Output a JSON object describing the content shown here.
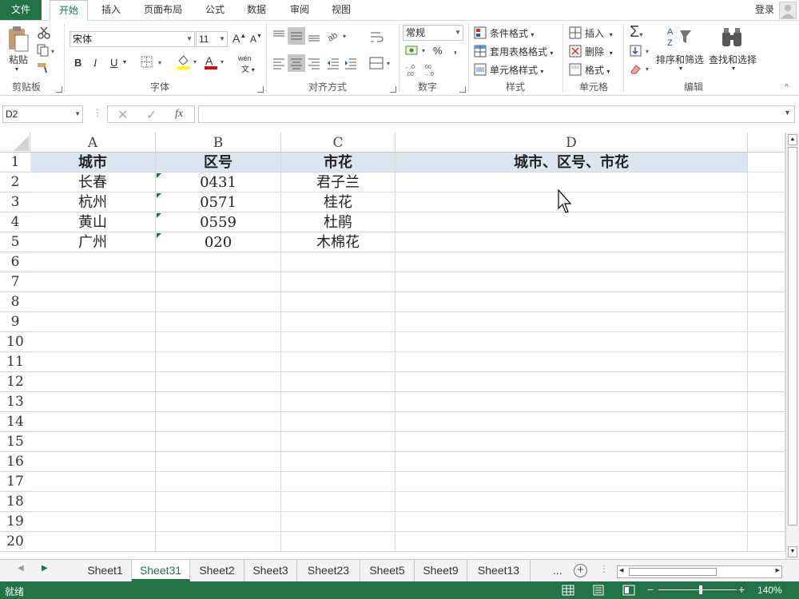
{
  "tabs": {
    "file": "文件",
    "home": "开始",
    "insert": "插入",
    "page_layout": "页面布局",
    "formulas": "公式",
    "data": "数据",
    "review": "审阅",
    "view": "视图",
    "login": "登录"
  },
  "ribbon": {
    "clipboard": {
      "paste": "粘贴",
      "label": "剪贴板"
    },
    "font": {
      "name": "宋体",
      "size": "11",
      "bold": "B",
      "italic": "I",
      "underline": "U",
      "label": "字体",
      "phonetic": "wén"
    },
    "alignment": {
      "label": "对齐方式"
    },
    "number": {
      "format": "常规",
      "percent": "%",
      "comma": ",",
      "label": "数字"
    },
    "styles": {
      "conditional": "条件格式",
      "table": "套用表格格式",
      "cell": "单元格样式",
      "label": "样式"
    },
    "cells": {
      "insert": "插入",
      "delete": "删除",
      "format": "格式",
      "label": "单元格"
    },
    "editing": {
      "sort": "排序和筛选",
      "find": "查找和选择",
      "label": "编辑"
    }
  },
  "formula_bar": {
    "name_box": "D2",
    "fx": "fx",
    "value": ""
  },
  "columns": [
    "A",
    "B",
    "C",
    "D"
  ],
  "rows": [
    "1",
    "2",
    "3",
    "4",
    "5",
    "6",
    "7",
    "8",
    "9",
    "10",
    "11",
    "12",
    "13",
    "14",
    "15",
    "16",
    "17",
    "18",
    "19",
    "20"
  ],
  "cells": {
    "header": [
      "城市",
      "区号",
      "市花",
      "城市、区号、市花"
    ],
    "data": [
      [
        "长春",
        "0431",
        "君子兰",
        ""
      ],
      [
        "杭州",
        "0571",
        "桂花",
        ""
      ],
      [
        "黄山",
        "0559",
        "杜鹃",
        ""
      ],
      [
        "广州",
        "020",
        "木棉花",
        ""
      ]
    ]
  },
  "sheets": [
    "Sheet1",
    "Sheet31",
    "Sheet2",
    "Sheet3",
    "Sheet23",
    "Sheet5",
    "Sheet9",
    "Sheet13"
  ],
  "active_sheet": "Sheet31",
  "sheet_more": "...",
  "status": {
    "ready": "就绪",
    "zoom": "140%"
  },
  "colors": {
    "accent": "#217346",
    "header_fill": "#dce6f1"
  }
}
